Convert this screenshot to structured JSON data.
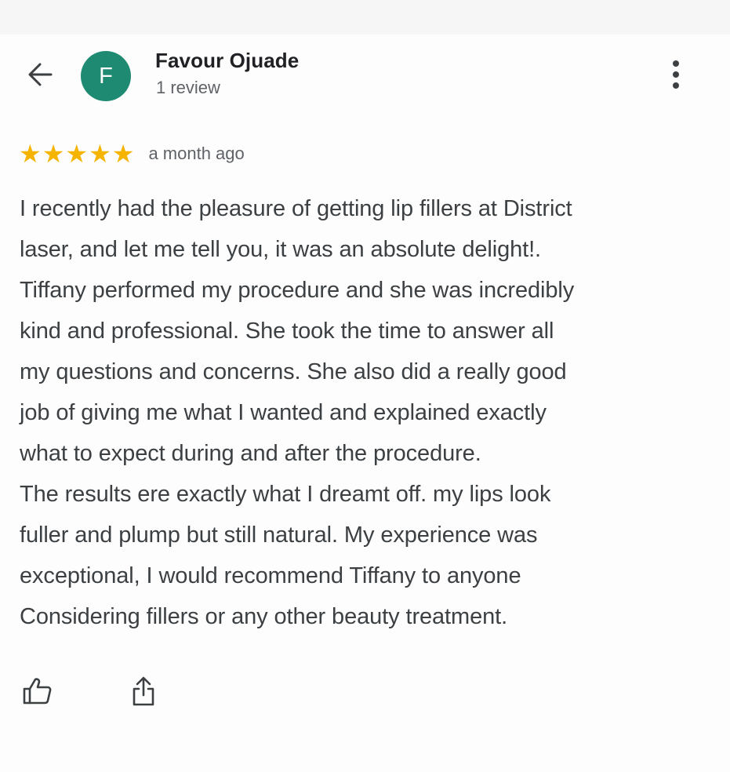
{
  "header": {
    "back_icon": "arrow-left-icon",
    "avatar_letter": "F",
    "avatar_color": "#1f8a72",
    "reviewer_name": "Favour Ojuade",
    "review_count": "1 review",
    "more_icon": "more-vert-icon"
  },
  "review": {
    "rating": 5,
    "rating_max": 5,
    "star_color": "#f5b400",
    "date": "a month ago",
    "lines": [
      "I recently had the pleasure of getting lip fillers at District",
      "laser, and let me tell you, it was an absolute delight!.",
      "Tiffany performed my procedure and she was incredibly",
      "kind and professional. She took the time to answer all",
      "my questions and concerns. She also did a really good",
      "job of giving me what I wanted and explained exactly",
      "what to expect during and after the procedure.",
      "The results ere exactly what I dreamt off. my lips look",
      "fuller and plump but still natural. My experience was",
      "exceptional, I would recommend Tiffany to anyone",
      "Considering fillers or any other beauty treatment."
    ]
  },
  "actions": {
    "like_icon": "thumbs-up-icon",
    "share_icon": "share-icon"
  }
}
